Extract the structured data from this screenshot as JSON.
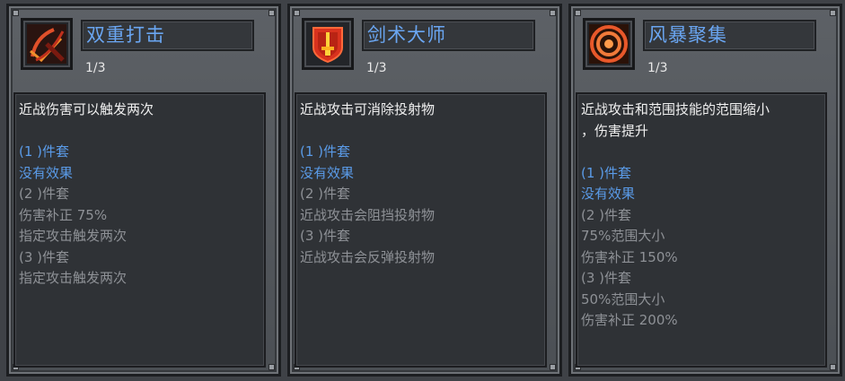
{
  "cards": [
    {
      "title": "双重打击",
      "level": "1/3",
      "icon": "double-strike-icon",
      "description": "近战伤害可以触发两次",
      "lines": [
        {
          "text": "(1 )件套",
          "color": "blue"
        },
        {
          "text": "没有效果",
          "color": "blue"
        },
        {
          "text": "(2 )件套",
          "color": "gray"
        },
        {
          "text": "伤害补正 75%",
          "color": "gray"
        },
        {
          "text": "指定攻击触发两次",
          "color": "gray"
        },
        {
          "text": "(3 )件套",
          "color": "gray"
        },
        {
          "text": "指定攻击触发两次",
          "color": "gray"
        }
      ]
    },
    {
      "title": "剑术大师",
      "level": "1/3",
      "icon": "sword-shield-icon",
      "description": "近战攻击可消除投射物",
      "lines": [
        {
          "text": "(1 )件套",
          "color": "blue"
        },
        {
          "text": "没有效果",
          "color": "blue"
        },
        {
          "text": "(2 )件套",
          "color": "gray"
        },
        {
          "text": "近战攻击会阻挡投射物",
          "color": "gray"
        },
        {
          "text": "(3 )件套",
          "color": "gray"
        },
        {
          "text": "近战攻击会反弹投射物",
          "color": "gray"
        }
      ]
    },
    {
      "title": "风暴聚集",
      "level": "1/3",
      "icon": "storm-target-icon",
      "description_line1": "近战攻击和范围技能的范围缩小",
      "description_line2": "，伤害提升",
      "lines": [
        {
          "text": "(1 )件套",
          "color": "blue"
        },
        {
          "text": "没有效果",
          "color": "blue"
        },
        {
          "text": "(2 )件套",
          "color": "gray"
        },
        {
          "text": "75%范围大小",
          "color": "gray"
        },
        {
          "text": "伤害补正 150%",
          "color": "gray"
        },
        {
          "text": "(3 )件套",
          "color": "gray"
        },
        {
          "text": "50%范围大小",
          "color": "gray"
        },
        {
          "text": "伤害补正 200%",
          "color": "gray"
        }
      ]
    }
  ],
  "colors": {
    "title": "#6aa6f2",
    "active_set": "#5a9be8",
    "inactive_set": "#8e9196",
    "description": "#f0f0f0"
  }
}
